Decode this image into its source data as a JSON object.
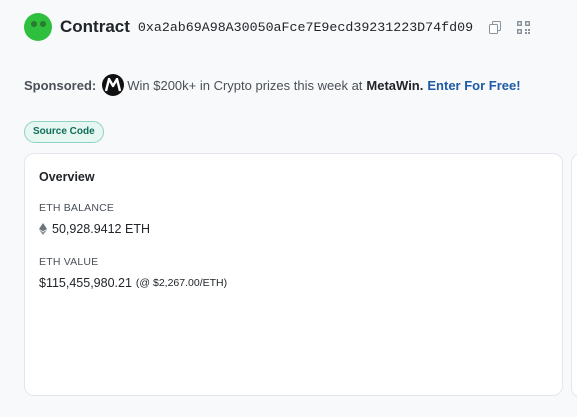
{
  "header": {
    "title": "Contract",
    "address": "0xa2ab69A98A30050aFce7E9ecd39231223D74fd09"
  },
  "sponsor": {
    "label": "Sponsored:",
    "text": "Win $200k+ in Crypto prizes this week at",
    "brand": "MetaWin.",
    "cta": "Enter For Free!"
  },
  "badge": {
    "label": "Source Code"
  },
  "overview": {
    "title": "Overview",
    "eth_balance_label": "ETH BALANCE",
    "eth_balance_value": "50,928.9412 ETH",
    "eth_value_label": "ETH VALUE",
    "eth_value_value": "$115,455,980.21",
    "eth_value_rate": "(@ $2,267.00/ETH)"
  },
  "colors": {
    "accent": "#1e5aa8",
    "badge_bg": "#e6f6f1",
    "badge_text": "#0d6e57",
    "avatar": "#2fbf3e"
  },
  "icons": [
    "copy-icon",
    "qr-code-icon",
    "metawin-logo-icon",
    "ethereum-icon"
  ]
}
